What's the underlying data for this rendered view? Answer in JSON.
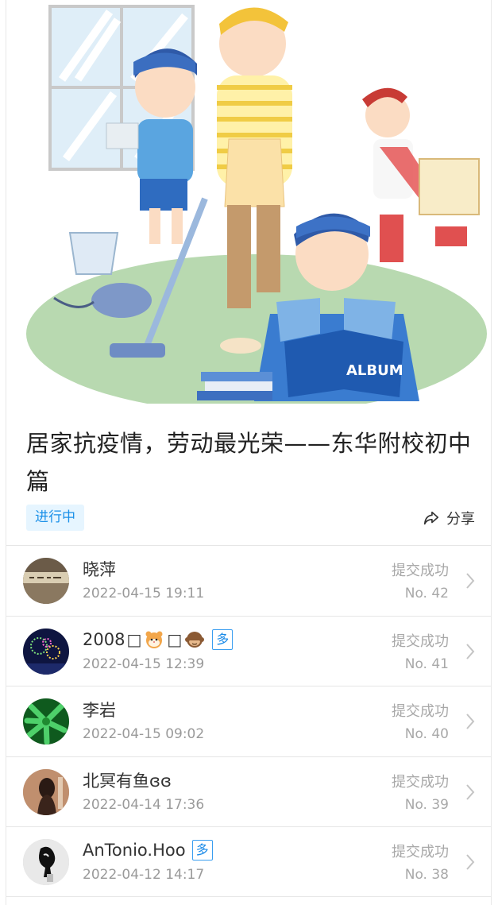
{
  "activity": {
    "title": "居家抗疫情，劳动最光荣——东华附校初中篇",
    "status_tag": "进行中",
    "share_label": "分享"
  },
  "hero_image": {
    "album_label": "ALBUM"
  },
  "submissions": [
    {
      "name": "晓萍",
      "date": "2022-04-15 19:11",
      "status": "提交成功",
      "number": "No. 42",
      "multi": false,
      "avatar": "photo-hall"
    },
    {
      "name": "2008",
      "name_suffix_glyph": "□",
      "date": "2022-04-15 12:39",
      "status": "提交成功",
      "number": "No. 41",
      "multi": true,
      "multi_label": "多",
      "avatar": "photo-fireworks",
      "emojis": [
        "hamster-face",
        "see-no-evil-monkey"
      ]
    },
    {
      "name": "李岩",
      "date": "2022-04-15 09:02",
      "status": "提交成功",
      "number": "No. 40",
      "multi": false,
      "avatar": "photo-bamboo"
    },
    {
      "name": "北冥有鱼ɞɞ",
      "date": "2022-04-14 17:36",
      "status": "提交成功",
      "number": "No. 39",
      "multi": false,
      "avatar": "photo-girl"
    },
    {
      "name": "AnTonio.Hoo",
      "date": "2022-04-12 14:17",
      "status": "提交成功",
      "number": "No. 38",
      "multi": true,
      "multi_label": "多",
      "avatar": "photo-sketch"
    }
  ],
  "colors": {
    "tag_bg": "#e6f5ff",
    "tag_text": "#1a90e8",
    "muted_text": "#a8a8a8"
  }
}
